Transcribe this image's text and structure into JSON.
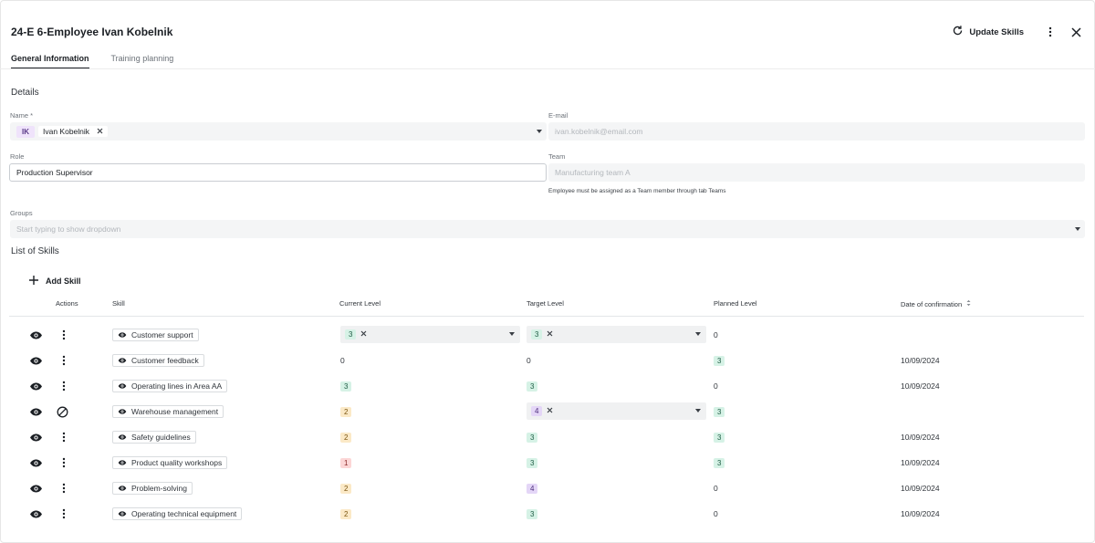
{
  "header": {
    "title": "24-E 6-Employee Ivan Kobelnik",
    "update_label": "Update Skills"
  },
  "tabs": [
    {
      "label": "General Information"
    },
    {
      "label": "Training planning"
    }
  ],
  "details": {
    "title": "Details",
    "name_label": "Name *",
    "name_initials": "IK",
    "name_value": "Ivan Kobelnik",
    "email_label": "E-mail",
    "email_placeholder": "ivan.kobelnik@email.com",
    "role_label": "Role",
    "role_value": "Production Supervisor",
    "team_label": "Team",
    "team_placeholder": "Manufacturing team A",
    "team_helper": "Employee must be assigned as a Team member through tab Teams",
    "groups_label": "Groups",
    "groups_placeholder": "Start typing to show dropdown"
  },
  "skills": {
    "title": "List of Skills",
    "add_label": "Add Skill",
    "columns": {
      "actions": "Actions",
      "skill": "Skill",
      "current": "Current Level",
      "target": "Target Level",
      "planned": "Planned Level",
      "date": "Date of confirmation"
    },
    "rows": [
      {
        "skill": "Customer support",
        "current": "3",
        "target": "3",
        "planned": "0",
        "date": ""
      },
      {
        "skill": "Customer feedback",
        "current": "0",
        "target": "0",
        "planned": "3",
        "date": "10/09/2024"
      },
      {
        "skill": "Operating lines in Area AA",
        "current": "3",
        "target": "3",
        "planned": "0",
        "date": "10/09/2024"
      },
      {
        "skill": "Warehouse management",
        "current": "2",
        "target": "4",
        "planned": "3",
        "date": ""
      },
      {
        "skill": "Safety guidelines",
        "current": "2",
        "target": "3",
        "planned": "3",
        "date": "10/09/2024"
      },
      {
        "skill": "Product quality workshops",
        "current": "1",
        "target": "3",
        "planned": "3",
        "date": "10/09/2024"
      },
      {
        "skill": "Problem-solving",
        "current": "2",
        "target": "4",
        "planned": "0",
        "date": "10/09/2024"
      },
      {
        "skill": "Operating technical equipment",
        "current": "2",
        "target": "3",
        "planned": "0",
        "date": "10/09/2024"
      }
    ]
  },
  "colors": {
    "accent": "#1b1f24",
    "level_green": "#d6f2e6",
    "level_orange": "#fbe9c7",
    "level_red": "#fcd6d6",
    "level_purple": "#e4d6f7"
  }
}
